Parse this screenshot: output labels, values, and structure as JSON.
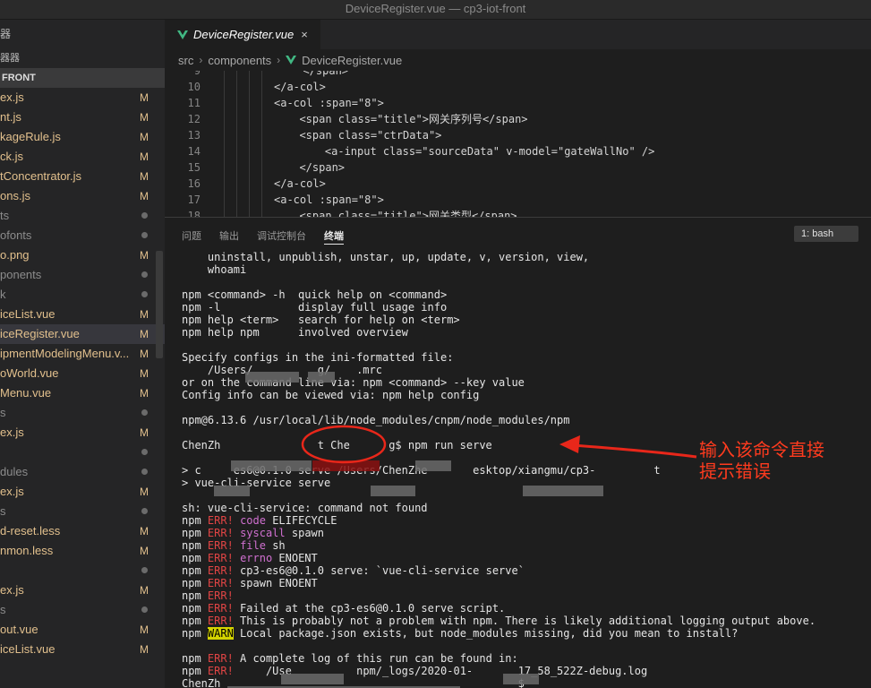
{
  "window_title": "DeviceRegister.vue — cp3-iot-front",
  "sidebar": {
    "top_label": "器",
    "section_label": "器器",
    "project_label": "FRONT",
    "items": [
      {
        "name": "ex.js",
        "status": "M"
      },
      {
        "name": "nt.js",
        "status": "M"
      },
      {
        "name": "kageRule.js",
        "status": "M"
      },
      {
        "name": "ck.js",
        "status": "M"
      },
      {
        "name": "tConcentrator.js",
        "status": "M"
      },
      {
        "name": "ons.js",
        "status": "M"
      },
      {
        "name": "ts",
        "status": "dot"
      },
      {
        "name": "ofonts",
        "status": "dot"
      },
      {
        "name": "o.png",
        "status": "M"
      },
      {
        "name": "ponents",
        "status": "dot"
      },
      {
        "name": "k",
        "status": "dot"
      },
      {
        "name": "iceList.vue",
        "status": "M"
      },
      {
        "name": "iceRegister.vue",
        "status": "M"
      },
      {
        "name": "ipmentModelingMenu.v...",
        "status": "M"
      },
      {
        "name": "oWorld.vue",
        "status": "M"
      },
      {
        "name": "Menu.vue",
        "status": "M"
      },
      {
        "name": "s",
        "status": "dot"
      },
      {
        "name": "ex.js",
        "status": "M"
      },
      {
        "name": "",
        "status": "dot"
      },
      {
        "name": "dules",
        "status": "dot"
      },
      {
        "name": "ex.js",
        "status": "M"
      },
      {
        "name": "s",
        "status": "dot"
      },
      {
        "name": "d-reset.less",
        "status": "M"
      },
      {
        "name": "nmon.less",
        "status": "M"
      },
      {
        "name": "",
        "status": "dot"
      },
      {
        "name": "ex.js",
        "status": "M"
      },
      {
        "name": "s",
        "status": "dot"
      },
      {
        "name": "out.vue",
        "status": "M"
      },
      {
        "name": "iceList.vue",
        "status": "M"
      }
    ]
  },
  "tab": {
    "label": "DeviceRegister.vue",
    "close": "×"
  },
  "breadcrumb": {
    "part1": "src",
    "part2": "components",
    "file": "DeviceRegister.vue"
  },
  "code_lines": [
    {
      "n": "9",
      "t": "  </span>"
    },
    {
      "n": "10",
      "t": "</a-col>"
    },
    {
      "n": "11",
      "t": "<a-col :span=\"8\">"
    },
    {
      "n": "12",
      "t": "  <span class=\"title\">网关序列号</span>"
    },
    {
      "n": "13",
      "t": "  <span class=\"ctrData\">"
    },
    {
      "n": "14",
      "t": "    <a-input class=\"sourceData\" v-model=\"gateWallNo\" />"
    },
    {
      "n": "15",
      "t": "  </span>"
    },
    {
      "n": "16",
      "t": "</a-col>"
    },
    {
      "n": "17",
      "t": "<a-col :span=\"8\">"
    },
    {
      "n": "18",
      "t": "  <span class=\"title\">网关类型</span>"
    }
  ],
  "panel": {
    "tabs": [
      "问题",
      "输出",
      "调试控制台",
      "终端"
    ],
    "terminal_select": "1: bash"
  },
  "terminal": {
    "l1": "    uninstall, unpublish, unstar, up, update, v, version, view,",
    "l2": "    whoami",
    "l3": "npm <command> -h  quick help on <command>",
    "l4": "npm -l            display full usage info",
    "l5": "npm help <term>   search for help on <term>",
    "l6": "npm help npm      involved overview",
    "l7": "Specify configs in the ini-formatted file:",
    "l8": "    /Users/          g/    .mrc",
    "l9": "or on the command line via: npm <command> --key value",
    "l10": "Config info can be viewed via: npm help config",
    "l11": "npm@6.13.6 /usr/local/lib/node_modules/cnpm/node_modules/npm",
    "l12": "ChenZh               t Che      g$ npm run serve",
    "l13": "> c     es6@0.1.0 serve /Users/ChenZhe       esktop/xiangmu/cp3-         t",
    "l14": "> vue-cli-service serve",
    "l15": "sh: vue-cli-service: command not found",
    "npm": "npm",
    "err": "ERR!",
    "warn": "WARN",
    "e1k": "code",
    "e1v": " ELIFECYCLE",
    "e2k": "syscall",
    "e2v": " spawn",
    "e3k": "file",
    "e3v": " sh",
    "e4k": "errno",
    "e4v": " ENOENT",
    "e5": " cp3-es6@0.1.0 serve: `vue-cli-service serve`",
    "e6": " spawn ENOENT",
    "e7": "",
    "e8": " Failed at the cp3-es6@0.1.0 serve script.",
    "e9": " This is probably not a problem with npm. There is likely additional logging output above.",
    "w1": " Local package.json exists, but node_modules missing, did you mean to install?",
    "e10": " A complete log of this run can be found in:",
    "e11": "     /Use          npm/_logs/2020-01-       17_58_522Z-debug.log",
    "last": "ChenZh                                              $ "
  },
  "annotation": {
    "text_line1": "输入该命令直接",
    "text_line2": "提示错误",
    "color": "#ff3b1e"
  }
}
